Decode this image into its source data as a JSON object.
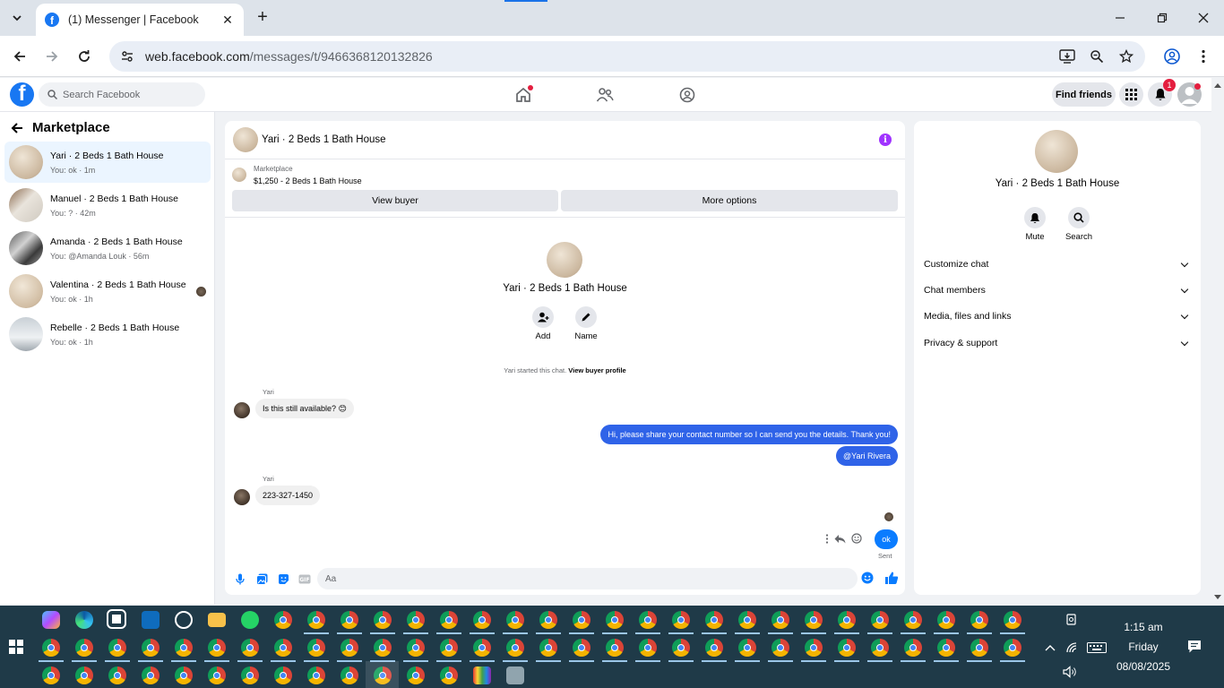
{
  "browser": {
    "tab_title": "(1) Messenger | Facebook",
    "url_host": "web.facebook.com",
    "url_path": "/messages/t/9466368120132826"
  },
  "fb": {
    "search_placeholder": "Search Facebook",
    "find_friends": "Find friends",
    "notification_count": "1"
  },
  "sidebar": {
    "title": "Marketplace",
    "conversations": [
      {
        "name": "Yari · 2 Beds 1 Bath House",
        "last": "You: ok · 1m"
      },
      {
        "name": "Manuel · 2 Beds 1 Bath House",
        "last": "You: ? · 42m"
      },
      {
        "name": "Amanda · 2 Beds 1 Bath House",
        "last": "You: @Amanda Louk · 56m"
      },
      {
        "name": "Valentina · 2 Beds 1 Bath House",
        "last": "You: ok · 1h"
      },
      {
        "name": "Rebelle · 2 Beds 1 Bath House",
        "last": "You: ok · 1h"
      }
    ]
  },
  "chat": {
    "header_name": "Yari · 2 Beds 1 Bath House",
    "marketplace_label": "Marketplace",
    "listing": "$1,250 - 2 Beds 1 Bath House",
    "view_buyer": "View buyer",
    "more_options": "More options",
    "center_name": "Yari · 2 Beds 1 Bath House",
    "add_label": "Add",
    "name_label": "Name",
    "system_msg": "Yari started this chat.",
    "system_link": "View buyer profile",
    "messages": [
      {
        "sender": "Yari",
        "text": "Is this still available? 😊"
      },
      {
        "text": "Hi, please share your contact number so I can send you the details. Thank you!"
      },
      {
        "text": "@Yari Rivera"
      },
      {
        "sender": "Yari",
        "text": "223-327-1450"
      },
      {
        "text": "ok"
      }
    ],
    "sent_label": "Sent",
    "composer_placeholder": "Aa"
  },
  "info_panel": {
    "name": "Yari · 2 Beds 1 Bath House",
    "mute": "Mute",
    "search": "Search",
    "rows": [
      "Customize chat",
      "Chat members",
      "Media, files and links",
      "Privacy & support"
    ]
  },
  "taskbar": {
    "time": "1:15 am",
    "day": "Friday",
    "date": "08/08/2025"
  },
  "colors": {
    "fb_blue": "#1877f2",
    "outgoing_bubble": "#2f63e8",
    "ok_bubble": "#0a7cff",
    "info_purple": "#a033ff",
    "taskbar": "#1f3a48"
  }
}
